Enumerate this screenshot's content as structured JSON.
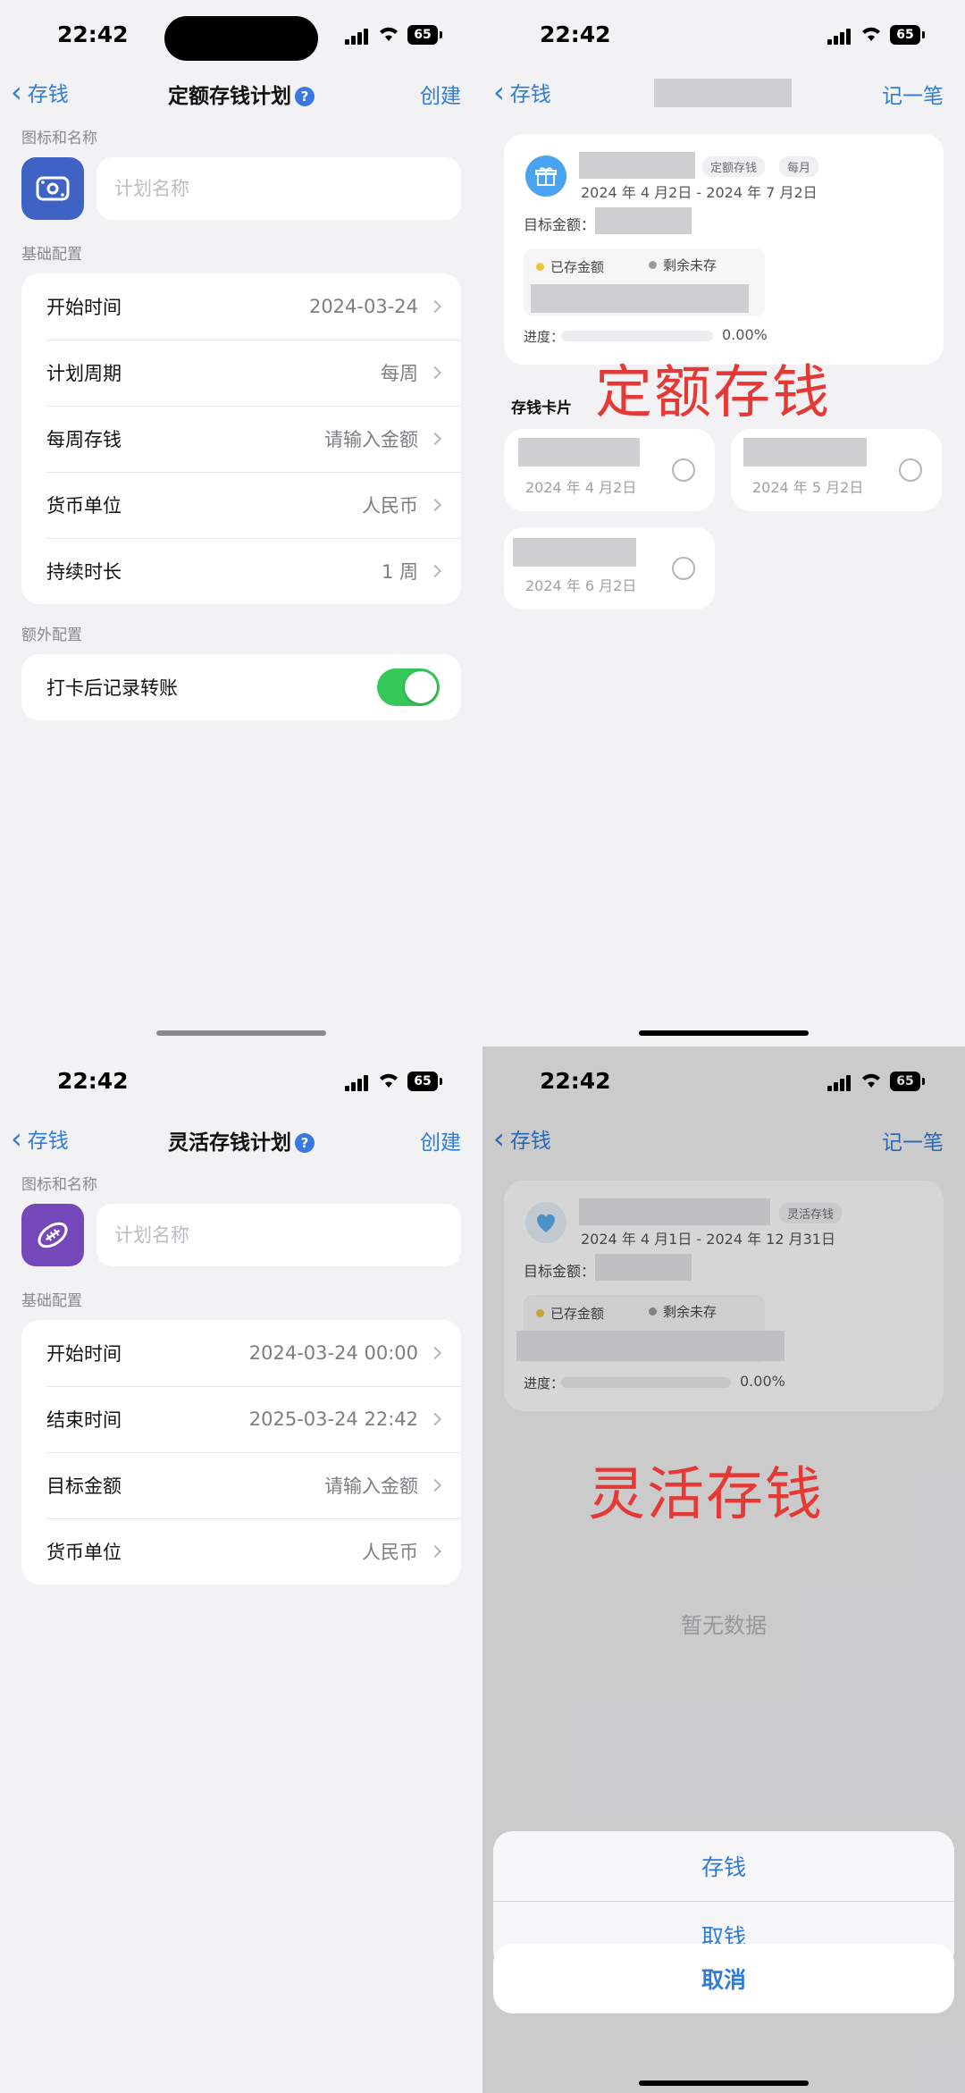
{
  "status": {
    "time": "22:42",
    "battery": "65"
  },
  "screen1": {
    "nav": {
      "back": "存钱",
      "title": "定额存钱计划",
      "action": "创建"
    },
    "icon_section": "图标和名称",
    "name_placeholder": "计划名称",
    "basic_section": "基础配置",
    "rows": [
      {
        "label": "开始时间",
        "value": "2024-03-24"
      },
      {
        "label": "计划周期",
        "value": "每周"
      },
      {
        "label": "每周存钱",
        "value": "请输入金额"
      },
      {
        "label": "货币单位",
        "value": "人民币"
      },
      {
        "label": "持续时长",
        "value": "1 周"
      }
    ],
    "extra_section": "额外配置",
    "toggle_label": "打卡后记录转账",
    "toggle_on": true
  },
  "screen2": {
    "nav": {
      "back": "存钱",
      "action": "记一笔"
    },
    "tag1": "定额存钱",
    "tag2": "每月",
    "date_range": "2024 年 4 月2日 - 2024 年 7 月2日",
    "target_label": "目标金额：",
    "saved_label": "已存金额",
    "remaining_label": "剩余未存",
    "progress_label": "进度：",
    "progress_value": "0.00%",
    "progress_fraction": 0,
    "overlay_text": "定额存钱",
    "cards_section": "存钱卡片",
    "cards": [
      {
        "date": "2024 年 4 月2日"
      },
      {
        "date": "2024 年 5 月2日"
      },
      {
        "date": "2024 年 6 月2日"
      }
    ]
  },
  "screen3": {
    "nav": {
      "back": "存钱",
      "title": "灵活存钱计划",
      "action": "创建"
    },
    "icon_section": "图标和名称",
    "name_placeholder": "计划名称",
    "basic_section": "基础配置",
    "rows": [
      {
        "label": "开始时间",
        "value": "2024-03-24 00:00"
      },
      {
        "label": "结束时间",
        "value": "2025-03-24 22:42"
      },
      {
        "label": "目标金额",
        "value": "请输入金额"
      },
      {
        "label": "货币单位",
        "value": "人民币"
      }
    ]
  },
  "screen4": {
    "nav": {
      "back": "存钱",
      "action": "记一笔"
    },
    "tag1": "灵活存钱",
    "date_range": "2024 年 4 月1日 - 2024 年 12 月31日",
    "target_label": "目标金额：",
    "saved_label": "已存金额",
    "remaining_label": "剩余未存",
    "progress_label": "进度：",
    "progress_value": "0.00%",
    "progress_fraction": 0,
    "overlay_text": "灵活存钱",
    "empty_text": "暂无数据",
    "sheet_options": [
      "存钱",
      "取钱"
    ],
    "sheet_cancel": "取消"
  },
  "colors": {
    "accent": "#2f7cd8",
    "toggle": "#34c759",
    "red_label": "#e53935",
    "icon1": "#3f63c4",
    "icon3": "#7448b8"
  }
}
